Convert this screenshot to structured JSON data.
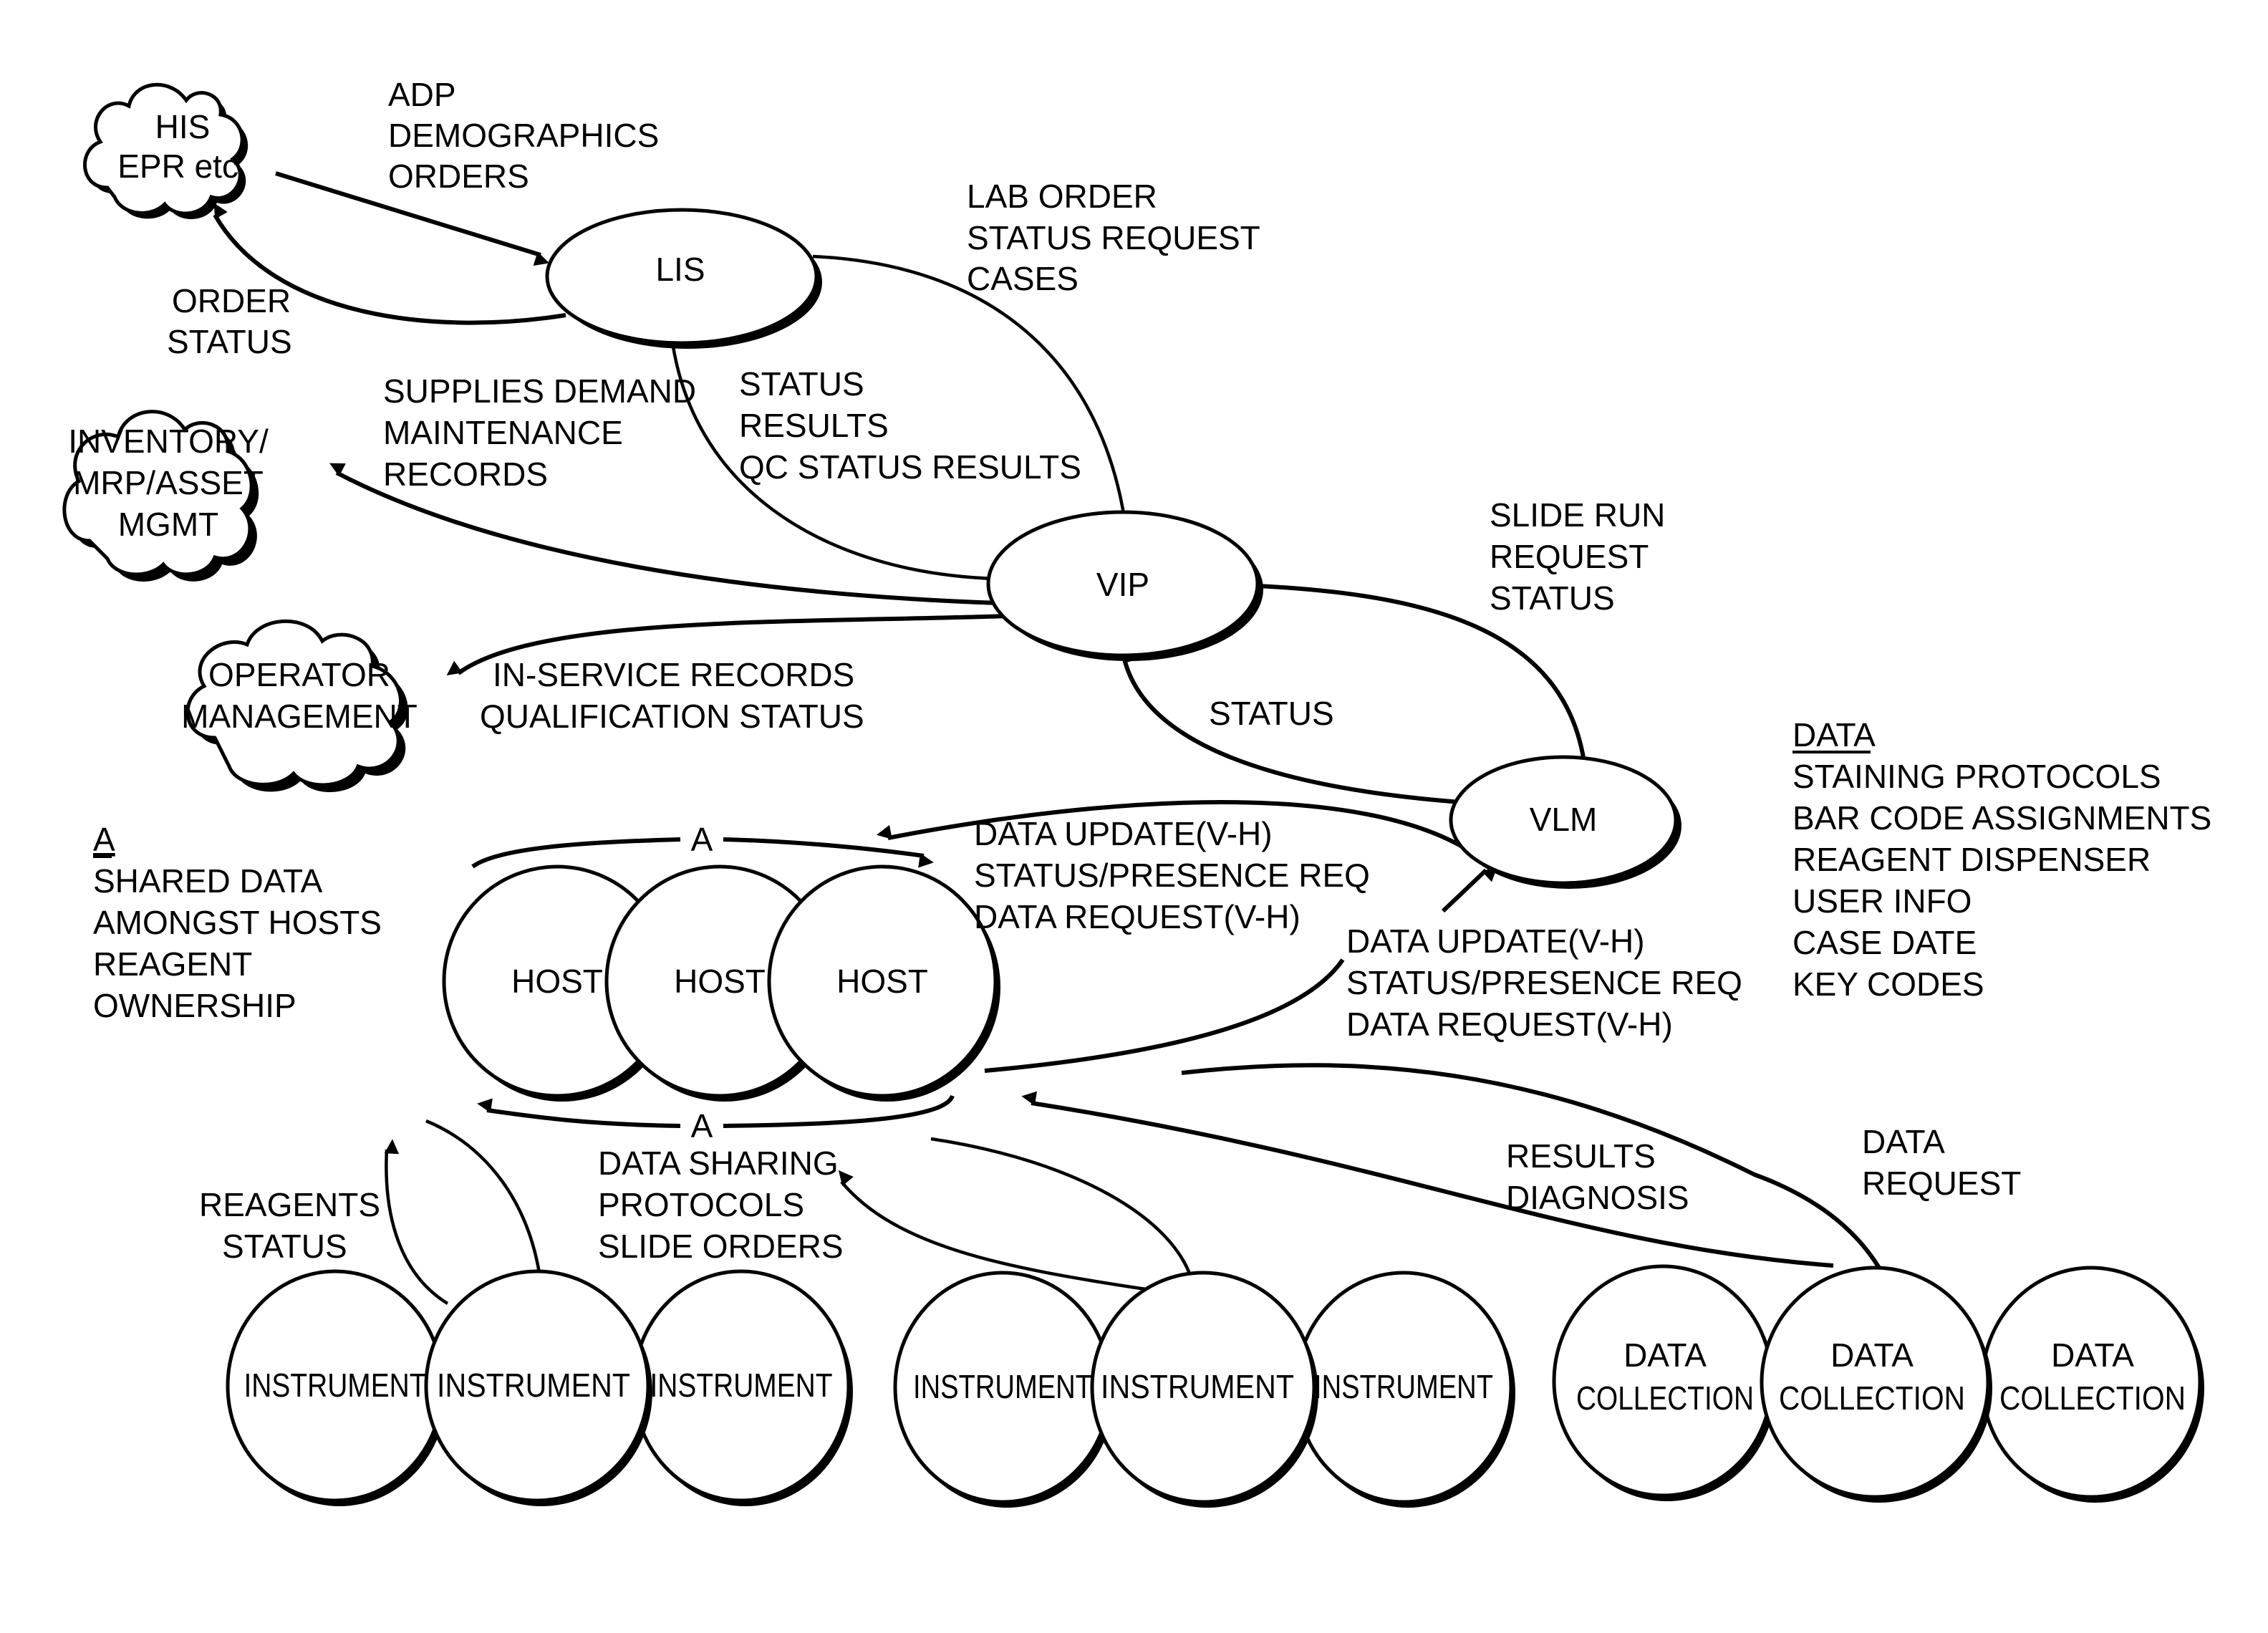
{
  "nodes": {
    "his": {
      "lines": [
        "HIS",
        "EPR etc."
      ]
    },
    "inventory": {
      "lines": [
        "INVENTORY/",
        "MRP/ASSET",
        "MGMT"
      ]
    },
    "operator": {
      "lines": [
        "OPERATOR",
        "MANAGEMENT"
      ]
    },
    "lis": {
      "label": "LIS"
    },
    "vip": {
      "label": "VIP"
    },
    "vlm": {
      "label": "VLM"
    },
    "hosts": [
      "HOST",
      "HOST",
      "HOST"
    ],
    "instruments_left": [
      "INSTRUMENT",
      "INSTRUMENT",
      "INSTRUMENT"
    ],
    "instruments_mid": [
      "INSTRUMENT",
      "INSTRUMENT",
      "INSTRUMENT"
    ],
    "data_collection": [
      {
        "lines": [
          "DATA",
          "COLLECTION"
        ]
      },
      {
        "lines": [
          "DATA",
          "COLLECTION"
        ]
      },
      {
        "lines": [
          "DATA",
          "COLLECTION"
        ]
      }
    ]
  },
  "edge_labels": {
    "his_to_lis": [
      "ADP",
      "DEMOGRAPHICS",
      "ORDERS"
    ],
    "lis_to_his": [
      "ORDER",
      "STATUS"
    ],
    "lis_to_vip": [
      "LAB ORDER",
      "STATUS REQUEST",
      "CASES"
    ],
    "vip_to_lis": [
      "STATUS",
      "RESULTS",
      "QC STATUS RESULTS"
    ],
    "vip_to_inventory": [
      "SUPPLIES DEMAND",
      "MAINTENANCE",
      "RECORDS"
    ],
    "vip_to_operator": [
      "IN-SERVICE RECORDS",
      "QUALIFICATION STATUS"
    ],
    "vip_to_vlm": [
      "SLIDE RUN",
      "REQUEST",
      "STATUS"
    ],
    "vlm_to_vip": [
      "STATUS"
    ],
    "vlm_to_host": [
      "DATA UPDATE(V-H)",
      "STATUS/PRESENCE REQ",
      "DATA REQUEST(V-H)"
    ],
    "host_to_vlm": [
      "DATA UPDATE(V-H)",
      "STATUS/PRESENCE REQ",
      "DATA REQUEST(V-H)"
    ],
    "host_shared_top": "A",
    "host_shared_bottom": "A",
    "host_to_instruments": [
      "DATA SHARING",
      "PROTOCOLS",
      "SLIDE ORDERS"
    ],
    "instruments_to_host": [
      "REAGENTS",
      "STATUS"
    ],
    "dc_to_host": [
      "RESULTS",
      "DIAGNOSIS"
    ],
    "host_to_dc": [
      "DATA",
      "REQUEST"
    ]
  },
  "legends": {
    "a_note": {
      "title": "A",
      "lines": [
        "SHARED DATA",
        "AMONGST HOSTS",
        "REAGENT",
        "OWNERSHIP"
      ]
    },
    "data_note": {
      "title": "DATA",
      "lines": [
        "STAINING PROTOCOLS",
        "BAR CODE ASSIGNMENTS",
        "REAGENT DISPENSER",
        "USER INFO",
        "CASE DATE",
        "KEY CODES"
      ]
    }
  }
}
